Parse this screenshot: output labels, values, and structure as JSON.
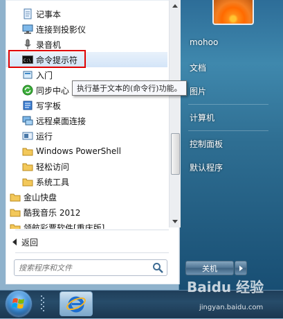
{
  "start_menu": {
    "programs": [
      {
        "label": "记事本",
        "icon": "notepad-icon"
      },
      {
        "label": "连接到投影仪",
        "icon": "projector-icon"
      },
      {
        "label": "录音机",
        "icon": "microphone-icon"
      },
      {
        "label": "命令提示符",
        "icon": "cmd-icon",
        "highlighted": true
      },
      {
        "label": "入门",
        "icon": "getting-started-icon"
      },
      {
        "label": "同步中心",
        "icon": "sync-center-icon"
      },
      {
        "label": "写字板",
        "icon": "wordpad-icon"
      },
      {
        "label": "远程桌面连接",
        "icon": "remote-desktop-icon"
      },
      {
        "label": "运行",
        "icon": "run-icon"
      },
      {
        "label": "Windows PowerShell",
        "icon": "folder-icon"
      },
      {
        "label": "轻松访问",
        "icon": "folder-icon"
      },
      {
        "label": "系统工具",
        "icon": "folder-icon"
      },
      {
        "label": "金山快盘",
        "icon": "folder-icon"
      },
      {
        "label": "酷我音乐 2012",
        "icon": "folder-icon"
      },
      {
        "label": "领航彩票软件[重庆版]",
        "icon": "folder-icon"
      }
    ],
    "tooltip": "执行基于文本的(命令行)功能。",
    "back_label": "返回",
    "search": {
      "placeholder": "搜索程序和文件"
    },
    "right_items": [
      {
        "label": "mohoo"
      },
      {
        "label": "文档"
      },
      {
        "label": "图片"
      },
      {
        "label": "计算机"
      },
      {
        "label": "控制面板"
      },
      {
        "label": "默认程序"
      }
    ],
    "shutdown_label": "关机"
  },
  "watermark": {
    "text": "Baidu 经验",
    "sub": "jingyan.baidu.com"
  },
  "colors": {
    "highlight_border": "#e00000",
    "taskbar": "#274c6a",
    "right_pane": "#2f6f93"
  }
}
